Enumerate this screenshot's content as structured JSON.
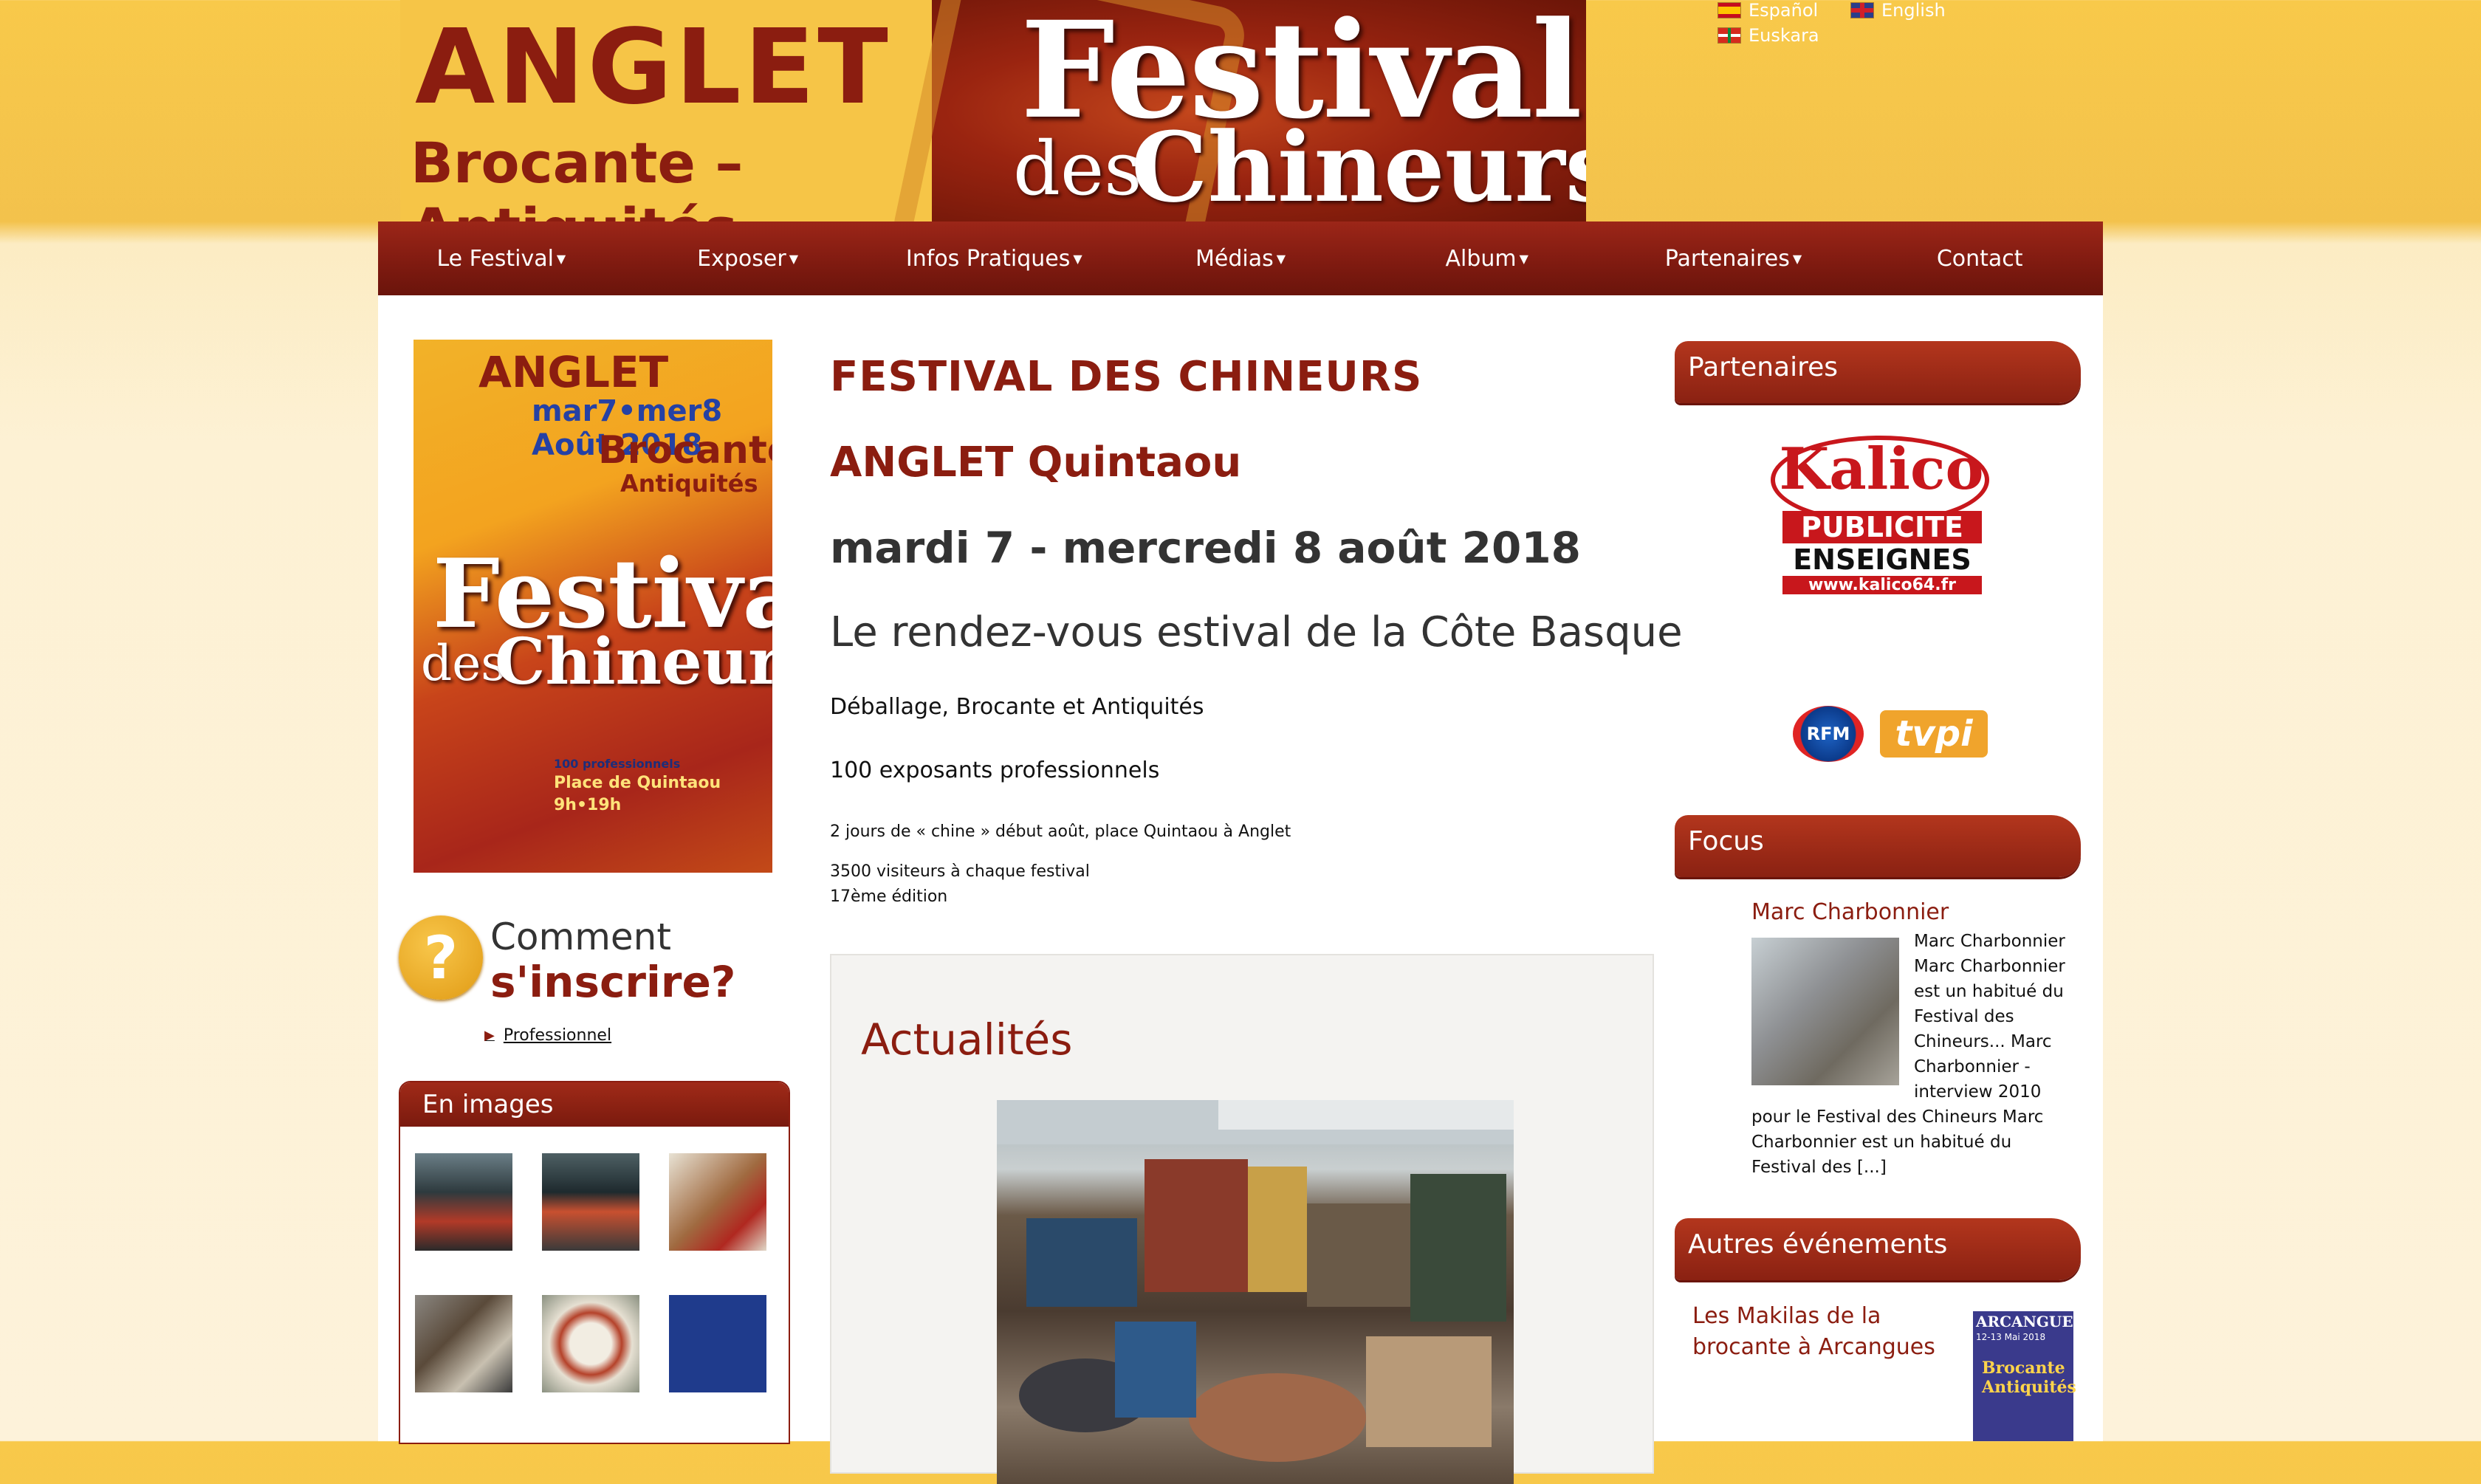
{
  "banner": {
    "title": "ANGLET",
    "subtitle": "Brocante – Antiquités",
    "festival": "Festival",
    "des": "des",
    "chineurs": "Chineurs"
  },
  "languages": [
    {
      "label": "Español",
      "flag": "flag-es-icon"
    },
    {
      "label": "English",
      "flag": "flag-en-icon"
    },
    {
      "label": "Euskara",
      "flag": "flag-eu-icon"
    }
  ],
  "nav": [
    {
      "label": "Le Festival",
      "dropdown": true
    },
    {
      "label": "Exposer",
      "dropdown": true
    },
    {
      "label": "Infos Pratiques",
      "dropdown": true
    },
    {
      "label": "Médias",
      "dropdown": true
    },
    {
      "label": "Album",
      "dropdown": true
    },
    {
      "label": "Partenaires",
      "dropdown": true
    },
    {
      "label": "Contact",
      "dropdown": false
    }
  ],
  "poster": {
    "city": "ANGLET",
    "dates": "mar7•mer8 Août 2018",
    "brocante": "Brocante",
    "antiquites": "Antiquités",
    "festival": "Festival",
    "des": "des",
    "chineurs": "Chineurs",
    "pros": "100 professionnels",
    "place": "Place de Quintaou",
    "hours": "9h•19h"
  },
  "inscrire": {
    "line1": "Comment",
    "line2": "s'inscrire?",
    "link": "Professionnel"
  },
  "en_images": {
    "title": "En images"
  },
  "main": {
    "title": "FESTIVAL DES CHINEURS",
    "location": "ANGLET Quintaou",
    "dates": "mardi 7 - mercredi 8 août 2018",
    "tagline": "Le rendez-vous estival de la Côte Basque",
    "line1": "Déballage, Brocante et Antiquités",
    "line2": "100 exposants professionnels",
    "line3": "2 jours de « chine » début août, place Quintaou à Anglet",
    "line4": "3500 visiteurs à chaque festival",
    "line5": "17ème édition",
    "actualites": "Actualités"
  },
  "sidebar": {
    "partenaires": "Partenaires",
    "kalico": {
      "name": "Kalico",
      "pub": "PUBLICITE",
      "ens": "ENSEIGNES",
      "url": "www.kalico64.fr"
    },
    "rfm": "RFM",
    "tvpi": "tvpi",
    "focus": "Focus",
    "focus_link": "Marc Charbonnier",
    "focus_text": "Marc Charbonnier Marc Charbonnier est un habitué du Festival des Chineurs... Marc Charbonnier - interview 2010 pour le Festival des Chineurs   Marc Charbonnier est un habitué du Festival des [...]",
    "autres": "Autres événements",
    "autres_link": "Les Makilas de la brocante à Arcangues",
    "arcangues": {
      "title": "ARCANGUES",
      "date": "12-13 Mai 2018",
      "label": "Brocante Antiquités"
    }
  },
  "colors": {
    "accent": "#8b1d10",
    "nav": "#7e1a10",
    "banner": "#f5c541"
  }
}
